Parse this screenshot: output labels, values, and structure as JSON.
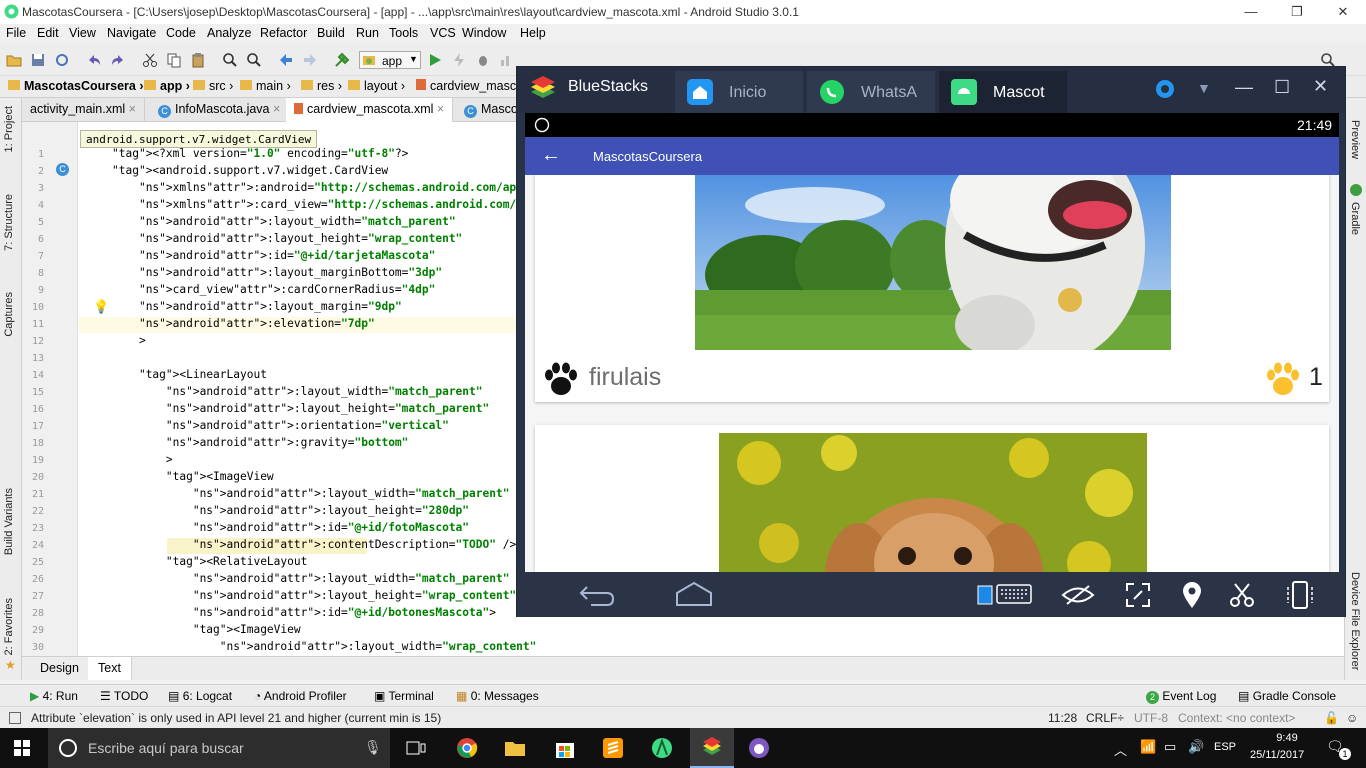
{
  "window": {
    "title": "MascotasCoursera - [C:\\Users\\josep\\Desktop\\MascotasCoursera] - [app] - ...\\app\\src\\main\\res\\layout\\cardview_mascota.xml - Android Studio 3.0.1"
  },
  "menu": [
    "File",
    "Edit",
    "View",
    "Navigate",
    "Code",
    "Analyze",
    "Refactor",
    "Build",
    "Run",
    "Tools",
    "VCS",
    "Window",
    "Help"
  ],
  "toolbar": {
    "run_config": "app"
  },
  "breadcrumb": [
    "MascotasCoursera",
    "app",
    "src",
    "main",
    "res",
    "layout",
    "cardview_masco"
  ],
  "editor_tabs": [
    {
      "label": "activity_main.xml"
    },
    {
      "label": "InfoMascota.java"
    },
    {
      "label": "cardview_mascota.xml"
    },
    {
      "label": "Masco"
    }
  ],
  "left_tools": [
    "1: Project",
    "7: Structure",
    "Captures",
    "Build Variants",
    "2: Favorites"
  ],
  "right_tools": [
    "Preview",
    "Gradle",
    "Device File Explorer"
  ],
  "tooltip": "android.support.v7.widget.CardView",
  "code_lines": [
    {
      "n": "1",
      "t": "<?xml version=\"1.0\" encoding=\"utf-8\"?>"
    },
    {
      "n": "2",
      "t": "<android.support.v7.widget.CardView"
    },
    {
      "n": "3",
      "t": "    xmlns:android=\"http://schemas.android.com/apk/res/android\""
    },
    {
      "n": "4",
      "t": "    xmlns:card_view=\"http://schemas.android.com/apk/res-auto\""
    },
    {
      "n": "5",
      "t": "    android:layout_width=\"match_parent\""
    },
    {
      "n": "6",
      "t": "    android:layout_height=\"wrap_content\""
    },
    {
      "n": "7",
      "t": "    android:id=\"@+id/tarjetaMascota\""
    },
    {
      "n": "8",
      "t": "    android:layout_marginBottom=\"3dp\""
    },
    {
      "n": "9",
      "t": "    card_view:cardCornerRadius=\"4dp\""
    },
    {
      "n": "10",
      "t": "    android:layout_margin=\"9dp\""
    },
    {
      "n": "11",
      "t": "    android:elevation=\"7dp\""
    },
    {
      "n": "12",
      "t": "    >"
    },
    {
      "n": "13",
      "t": ""
    },
    {
      "n": "14",
      "t": "    <LinearLayout"
    },
    {
      "n": "15",
      "t": "        android:layout_width=\"match_parent\""
    },
    {
      "n": "16",
      "t": "        android:layout_height=\"match_parent\""
    },
    {
      "n": "17",
      "t": "        android:orientation=\"vertical\""
    },
    {
      "n": "18",
      "t": "        android:gravity=\"bottom\""
    },
    {
      "n": "19",
      "t": "        >"
    },
    {
      "n": "20",
      "t": "        <ImageView"
    },
    {
      "n": "21",
      "t": "            android:layout_width=\"match_parent\""
    },
    {
      "n": "22",
      "t": "            android:layout_height=\"280dp\""
    },
    {
      "n": "23",
      "t": "            android:id=\"@+id/fotoMascota\""
    },
    {
      "n": "24",
      "t": "            android:contentDescription=\"TODO\" />"
    },
    {
      "n": "25",
      "t": "        <RelativeLayout"
    },
    {
      "n": "26",
      "t": "            android:layout_width=\"match_parent\""
    },
    {
      "n": "27",
      "t": "            android:layout_height=\"wrap_content\""
    },
    {
      "n": "28",
      "t": "            android:id=\"@+id/botonesMascota\">"
    },
    {
      "n": "29",
      "t": "            <ImageView"
    },
    {
      "n": "30",
      "t": "                android:layout_width=\"wrap_content\""
    }
  ],
  "design_tabs": [
    "Design",
    "Text"
  ],
  "tool_windows": {
    "left": [
      "4: Run",
      "TODO",
      "6: Logcat",
      "Android Profiler",
      "Terminal",
      "0: Messages"
    ],
    "right": [
      "Event Log",
      "Gradle Console"
    ],
    "event_log_count": "2"
  },
  "status": {
    "message": "Attribute `elevation` is only used in API level 21 and higher (current min is 15)",
    "position": "11:28",
    "line_sep": "CRLF÷",
    "encoding": "UTF-8",
    "context": "Context: <no context>"
  },
  "bluestacks": {
    "brand": "BlueStacks",
    "tabs": [
      "Inicio",
      "WhatsA",
      "Mascot"
    ],
    "clock": "21:49",
    "app_title": "MascotasCoursera",
    "cards": [
      {
        "name": "firulais",
        "likes": "1",
        "photo": "dog"
      },
      {
        "name": "",
        "likes": "",
        "photo": "rabbit"
      }
    ]
  },
  "taskbar": {
    "search_placeholder": "Escribe aquí para buscar",
    "language": "ESP",
    "time": "9:49",
    "date": "25/11/2017",
    "notifications": "1"
  }
}
